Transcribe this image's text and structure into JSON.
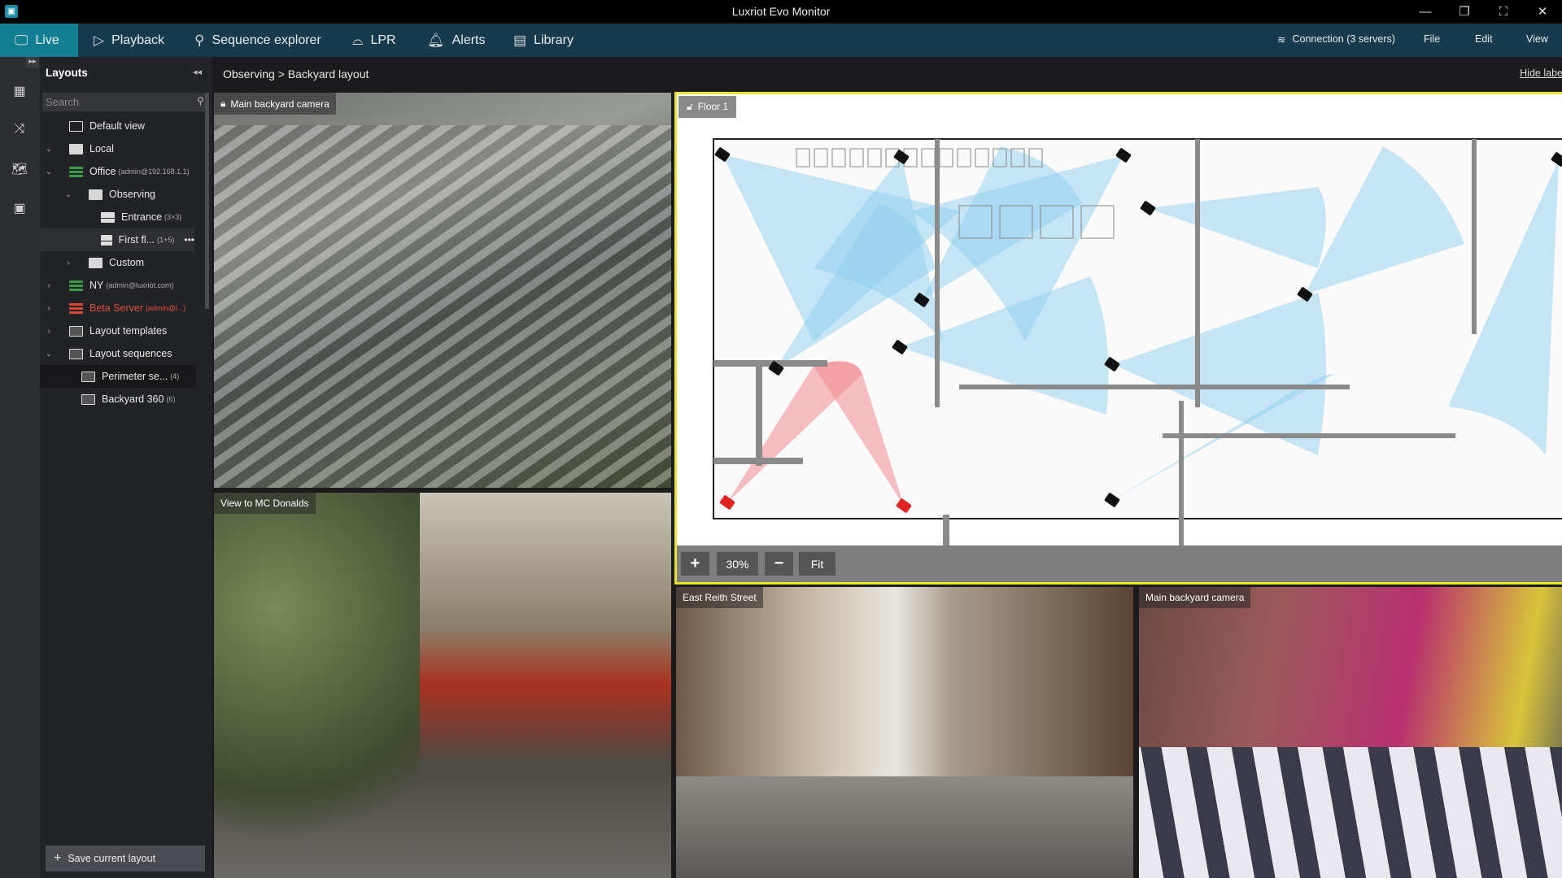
{
  "window": {
    "title": "Luxriot Evo Monitor"
  },
  "nav": {
    "tabs": [
      {
        "label": "Live",
        "icon": "monitor-icon"
      },
      {
        "label": "Playback",
        "icon": "play-icon"
      },
      {
        "label": "Sequence explorer",
        "icon": "sequence-icon"
      },
      {
        "label": "LPR",
        "icon": "car-icon"
      },
      {
        "label": "Alerts",
        "icon": "bell-icon"
      },
      {
        "label": "Library",
        "icon": "library-icon"
      }
    ],
    "connection": "Connection (3 servers)",
    "menus": [
      "File",
      "Edit",
      "View"
    ]
  },
  "sidebar": {
    "title": "Layouts",
    "search_placeholder": "Search",
    "items": [
      {
        "label": "Default view",
        "sub": ""
      },
      {
        "label": "Local",
        "sub": ""
      },
      {
        "label": "Office",
        "sub": "(admin@192.168.1.1)"
      },
      {
        "label": "Observing",
        "sub": ""
      },
      {
        "label": "Entrance",
        "sub": "(3×3)"
      },
      {
        "label": "First fl...",
        "sub": "(1+5)"
      },
      {
        "label": "Custom",
        "sub": ""
      },
      {
        "label": "NY",
        "sub": "(admin@luxriot.com)"
      },
      {
        "label": "Beta Server",
        "sub": "(admin@l...)"
      },
      {
        "label": "Layout templates",
        "sub": ""
      },
      {
        "label": "Layout sequences",
        "sub": ""
      },
      {
        "label": "Perimeter se...",
        "sub": "(4)"
      },
      {
        "label": "Backyard 360",
        "sub": "(6)"
      }
    ],
    "save_label": "Save current layout"
  },
  "breadcrumb": "Observing > Backyard layout",
  "hide_labels": "Hide labels",
  "tiles": {
    "t1": "Main backyard camera",
    "t2": "View to MC Donalds",
    "t3": "East Reith Street",
    "t4": "Main backyard camera"
  },
  "map": {
    "floor": "Floor 1",
    "zoom": "30%",
    "fit": "Fit",
    "plus": "+",
    "minus": "−"
  },
  "colors": {
    "accent": "#137f93",
    "nav": "#173a4d",
    "map_border": "#e7e62a",
    "alarm": "#e02424",
    "coverage": "#8fd0f0"
  }
}
